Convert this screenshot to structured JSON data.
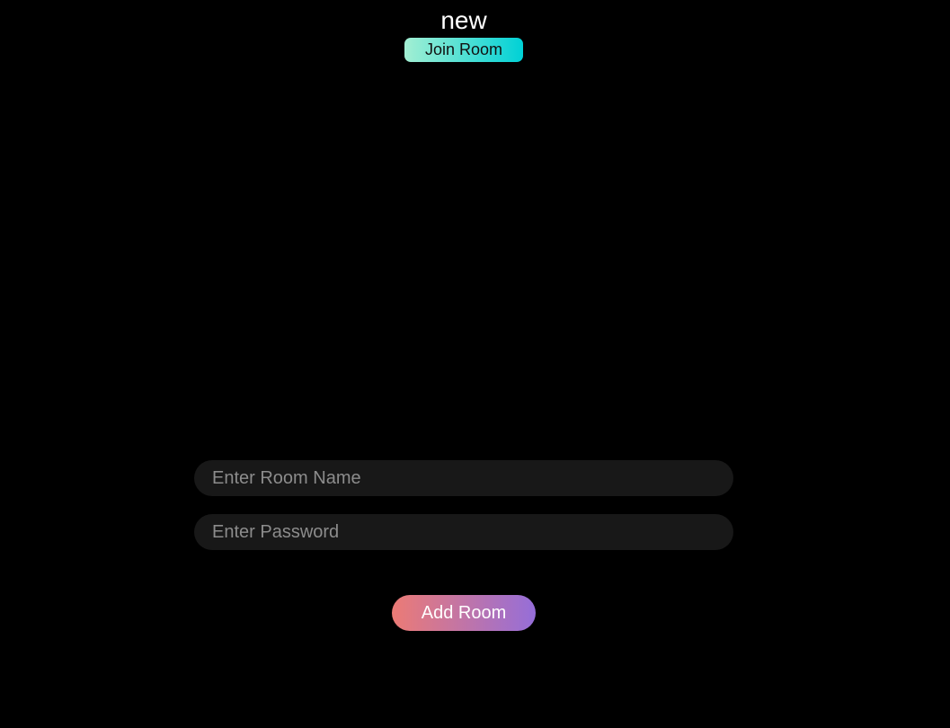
{
  "header": {
    "title": "new",
    "join_button_label": "Join Room"
  },
  "form": {
    "room_name_placeholder": "Enter Room Name",
    "password_placeholder": "Enter Password",
    "add_button_label": "Add Room"
  },
  "colors": {
    "background": "#000000",
    "join_gradient_start": "#a3efd3",
    "join_gradient_end": "#00d1d6",
    "add_gradient_start": "#ec7b75",
    "add_gradient_end": "#956ed9",
    "input_background": "#181818"
  }
}
